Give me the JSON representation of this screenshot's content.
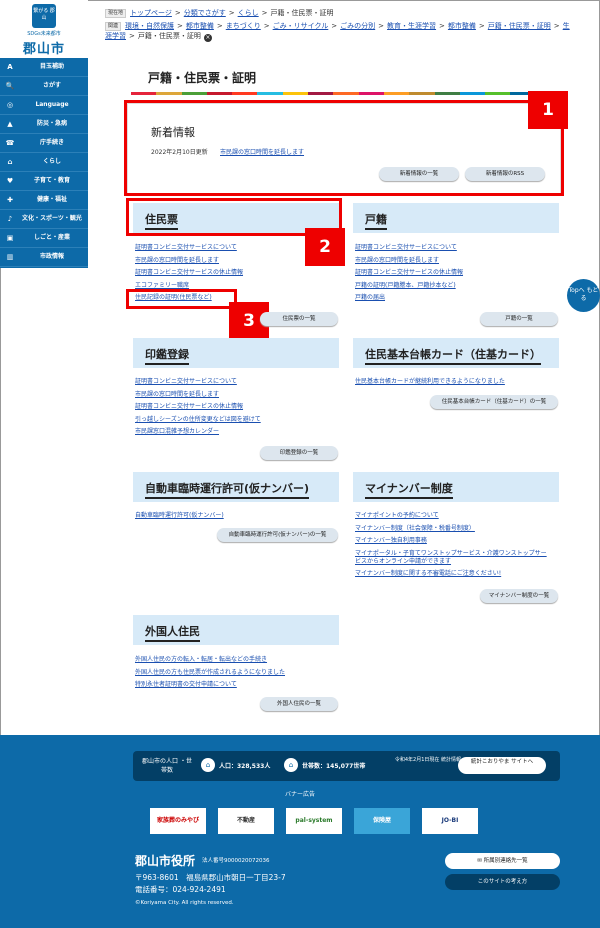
{
  "logo": {
    "emblem": "繋がる 郡山",
    "subtitle": "SDGs未来都市",
    "name": "郡山市"
  },
  "sidebar": {
    "items": [
      {
        "icon": "A",
        "label": "目玉補助"
      },
      {
        "icon": "🔍",
        "label": "さがす"
      },
      {
        "icon": "◎",
        "label": "Language"
      },
      {
        "icon": "▲",
        "label": "防災・急病"
      },
      {
        "icon": "☎",
        "label": "庁手続き"
      },
      {
        "icon": "⌂",
        "label": "くらし"
      },
      {
        "icon": "♥",
        "label": "子育て・教育"
      },
      {
        "icon": "✚",
        "label": "健康・福祉"
      },
      {
        "icon": "♪",
        "label": "文化・スポーツ・観光"
      },
      {
        "icon": "▣",
        "label": "しごと・産業"
      },
      {
        "icon": "▥",
        "label": "市政情報"
      }
    ]
  },
  "breadcrumb": {
    "row1_tag": "現在地",
    "row1": [
      "トップページ",
      "分類でさがす",
      "くらし",
      "戸籍・住民票・証明"
    ],
    "row2_tag": "関連",
    "row2a": [
      "環境・自然保護",
      "都市整備",
      "まちづくり",
      "ごみ・リサイクル",
      "ごみの分別",
      "教育・生涯学習",
      "都市整備",
      "戸籍・住民票・証明",
      "生"
    ],
    "row2b_first": "涯学習",
    "row2b_last": "戸籍・住民票・証明"
  },
  "page_title": "戸籍・住民票・証明",
  "rainbow_colors": [
    "#e5243b",
    "#dda63a",
    "#4c9f38",
    "#c5192d",
    "#ff3a21",
    "#26bde2",
    "#fcc30b",
    "#a21942",
    "#fd6925",
    "#dd1367",
    "#fd9d24",
    "#bf8b2e",
    "#3f7e44",
    "#0a97d9",
    "#56c02b",
    "#00689d",
    "#19486a"
  ],
  "news": {
    "title": "新着情報",
    "date": "2022年2月10日更新",
    "link": "市民課の窓口時間を延長します",
    "btn_list": "新着情報の一覧",
    "btn_rss": "新着情報のRSS"
  },
  "badges": [
    "1",
    "2",
    "3"
  ],
  "sections": {
    "juminhyo": {
      "title": "住民票",
      "links": [
        "証明書コンビニ交付サービスについて",
        "市民課の窓口時間を延長します",
        "証明書コンビニ交付サービスの休止情報",
        "エコファミリー職席",
        "住民記録の証明(住民票など)"
      ],
      "more": "住民票の一覧"
    },
    "koseki": {
      "title": "戸籍",
      "links": [
        "証明書コンビニ交付サービスについて",
        "市民課の窓口時間を延長します",
        "証明書コンビニ交付サービスの休止情報",
        "戸籍の証明(戸籍謄本、戸籍抄本など)",
        "戸籍の届出"
      ],
      "more": "戸籍の一覧"
    },
    "inkan": {
      "title": "印鑑登録",
      "links": [
        "証明書コンビニ交付サービスについて",
        "市民課の窓口時間を延長します",
        "証明書コンビニ交付サービスの休止情報",
        "引っ越しシーズンの住所変更などは図を避けて",
        "市民課窓口混雑予想カレンダー"
      ],
      "more": "印鑑登録の一覧"
    },
    "juki": {
      "title": "住民基本台帳カード（住基カード）",
      "links": [
        "住民基本台帳カードが継続利用できるようになりました"
      ],
      "more": "住民基本台帳カード（住基カード）の一覧"
    },
    "rinji": {
      "title": "自動車臨時運行許可(仮ナンバー)",
      "links": [
        "自動車臨時運行許可(仮ナンバー)"
      ],
      "more": "自動車臨時運行許可(仮ナンバー)の一覧"
    },
    "mynumber": {
      "title": "マイナンバー制度",
      "links": [
        "マイナポイントの予約について",
        "マイナンバー制度（社会保障・税番号制度）",
        "マイナンバー独自利用事務",
        "マイナポータル・子育てワンストップサービス・介護ワンストップサー",
        "ビスからオンライン申請ができます",
        "マイナンバー制度に関する不審電話にご注意ください!"
      ],
      "more": "マイナンバー制度の一覧"
    },
    "gaikoku": {
      "title": "外国人住民",
      "links": [
        "外国人住民の方の転入・転居・転出などの手続き",
        "外国人住民の方も住民票が作成されるようになりました",
        "特別永住者証明書の交付申請について"
      ],
      "more": "外国人住民の一覧"
    }
  },
  "top_button": "Topへ もどる",
  "footer": {
    "pop_label": "郡山市の人口 ・世帯数",
    "pop_value": "人口：328,533人",
    "household_value": "世帯数：145,077世帯",
    "as_of": "令和4年2月1日現在 統計情報",
    "stats_button": "統計こおりやま サイトへ",
    "banner_label": "バナー広告",
    "banners": [
      "家族葬のみやび",
      "不動産",
      "pal-system",
      "保険屋",
      "JO-BI"
    ],
    "city": "郡山市役所",
    "corp_no": "法人番号9000020072036",
    "address": "〒963-8601　福島県郡山市朝日一丁目23-7",
    "phone": "電話番号：024-924-2491",
    "copyright": "©Koriyama City. All rights reserved.",
    "btn_contact": "所属別連絡先一覧",
    "btn_policy": "このサイトの考え方"
  }
}
